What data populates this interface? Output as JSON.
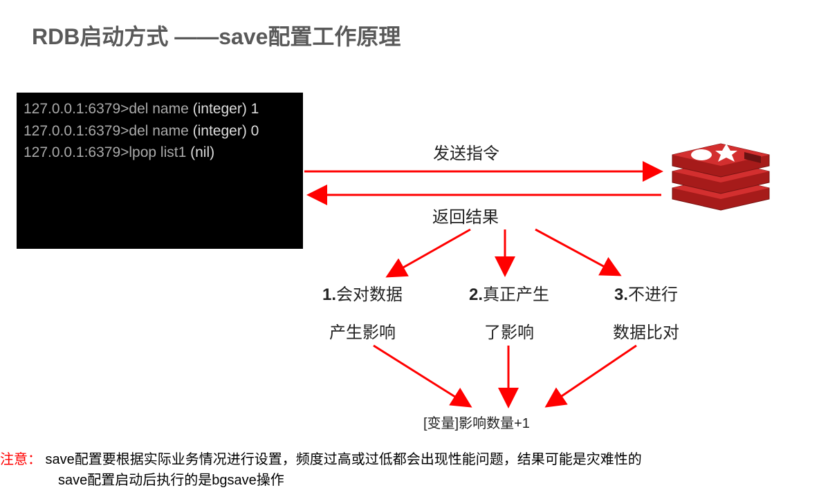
{
  "title": "RDB启动方式 ——save配置工作原理",
  "terminal": {
    "seg1_prompt": "127.0.0.1:6379>del name ",
    "seg1_out": " (integer) 1 ",
    "seg2_prompt": " 127.0.0.1:6379>del name ",
    "seg2_out": "(integer) 0 ",
    "seg3_prompt": " 127.0.0.1:6379>lpop list1 ",
    "seg3_out": " (nil)"
  },
  "arrows": {
    "send": "发送指令",
    "return": "返回结果"
  },
  "flow": {
    "item1": {
      "num": "1.",
      "t1": "会对数据",
      "t2": "产生影响"
    },
    "item2": {
      "num": "2.",
      "t1": "真正产生",
      "t2": "了影响"
    },
    "item3": {
      "num": "3.",
      "t1": "不进行",
      "t2": "数据比对"
    }
  },
  "bottom": "[变量]影响数量+1",
  "note": {
    "label": "注意：",
    "line1": " save配置要根据实际业务情况进行设置，频度过高或过低都会出现性能问题，结果可能是灾难性的",
    "line2": "save配置启动后执行的是bgsave操作"
  },
  "colors": {
    "red": "#d32027"
  }
}
